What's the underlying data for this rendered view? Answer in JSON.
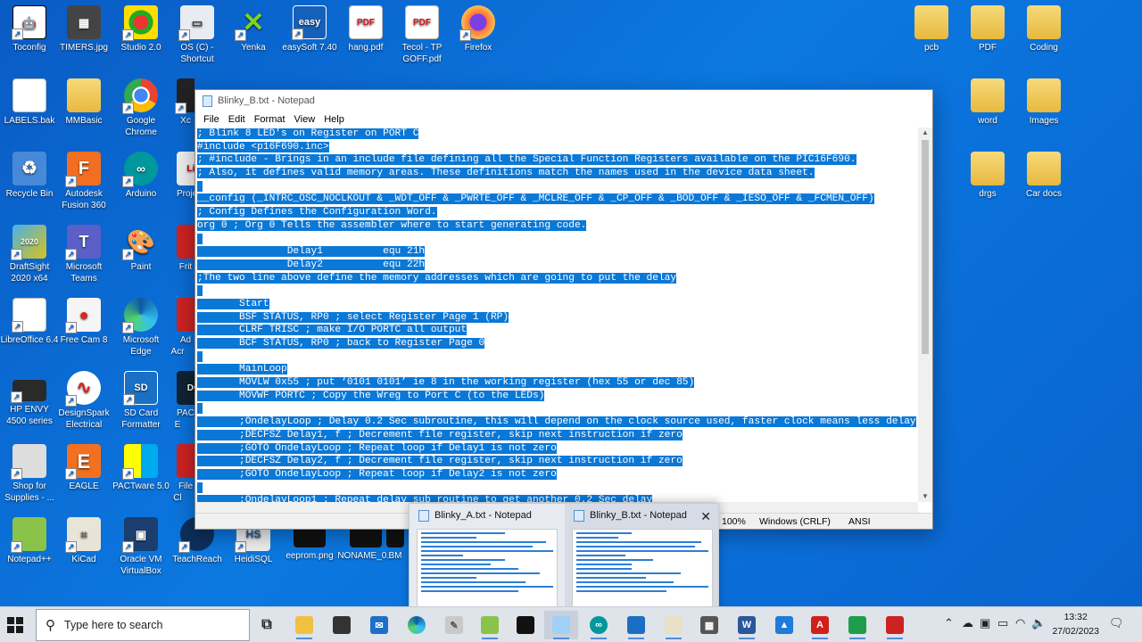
{
  "desktop": {
    "icons": {
      "toconfig": "Toconfig",
      "timers": "TIMERS.jpg",
      "studio": "Studio 2.0",
      "os_c": "OS (C) - Shortcut",
      "yenka": "Yenka",
      "easysoft": "easySoft 7.40",
      "hang": "hang.pdf",
      "tecol": "Tecol - TP GOFF.pdf",
      "firefox": "Firefox",
      "labels": "LABELS.bak",
      "mmbasic": "MMBasic",
      "chrome": "Google Chrome",
      "xc": "Xc",
      "recycle": "Recycle Bin",
      "fusion": "Autodesk Fusion 360",
      "arduino": "Arduino",
      "proje": "Proje",
      "draftsight": "DraftSight 2020 x64",
      "teams": "Microsoft Teams",
      "paint": "Paint",
      "frit": "Frit",
      "libreoffice": "LibreOffice 6.4",
      "freecam": "Free Cam 8",
      "edge": "Microsoft Edge",
      "ad": "Ad Acr",
      "hpenvy": "HP ENVY 4500 series",
      "designspark": "DesignSpark Electrical",
      "sdcard": "SD Card Formatter",
      "pactw": "PACTw E",
      "shop": "Shop for Supplies - ...",
      "eagle": "EAGLE",
      "pactware": "PACTware 5.0",
      "file": "File Cl",
      "notepadpp": "Notepad++",
      "kicad": "KiCad",
      "virtualbox": "Oracle VM VirtualBox",
      "teachreach": "TeachReach",
      "heidisql": "HeidiSQL",
      "eeprom": "eeprom.png",
      "noname": "NONAME_0...",
      "bm": "BM",
      "pcb": "pcb",
      "pdf": "PDF",
      "coding": "Coding",
      "word": "word",
      "images": "Images",
      "drgs": "drgs",
      "cardocs": "Car docs"
    }
  },
  "notepad": {
    "title": "Blinky_B.txt - Notepad",
    "menu": {
      "file": "File",
      "edit": "Edit",
      "format": "Format",
      "view": "View",
      "help": "Help"
    },
    "lines": [
      "; Blink 8 LED's on Register on PORT C",
      "#include <p16F690.inc>",
      "; #include - Brings in an include file defining all the Special Function Registers available on the PIC16F690.",
      "; Also, it defines valid memory areas. These definitions match the names used in the device data sheet.",
      "",
      "__config (_INTRC_OSC_NOCLKOUT & _WDT_OFF & _PWRTE_OFF & _MCLRE_OFF & _CP_OFF & _BOD_OFF & _IESO_OFF & _FCMEN_OFF)",
      "; Config Defines the Configuration Word.",
      "org 0 ; Org 0 Tells the assembler where to start generating code.",
      "",
      "               Delay1          equ 21h",
      "               Delay2          equ 22h",
      ";The two line above define the memory addresses which are going to put the delay",
      "",
      "       Start",
      "       BSF STATUS, RP0 ; select Register Page 1 (RP)",
      "       CLRF TRISC ; make I/O PORTC all output",
      "       BCF STATUS, RP0 ; back to Register Page 0",
      "",
      "       MainLoop",
      "       MOVLW 0x55 ; put ‘0101 0101’ ie 8 in the working register (hex 55 or dec 85)",
      "       MOVWF PORTC ; Copy the Wreg to Port C (to the LEDs)",
      "",
      "       ;OndelayLoop ; Delay 0.2 Sec subroutine, this will depend on the clock source used, faster clock means less delay",
      "       ;DECFSZ Delay1, f ; Decrement file register, skip next instruction if zero",
      "       ;GOTO OndelayLoop ; Repeat loop if Delay1 is not zero",
      "       ;DECFSZ Delay2, f ; Decrement file register, skip next instruction if zero",
      "       ;GOTO OndelayLoop ; Repeat loop if Delay2 is not zero",
      "",
      "       ;OndelayLoop1 ; Repeat delay sub routine to get another 0.2 Sec delay"
    ],
    "status": {
      "zoom": "100%",
      "line_ending": "Windows (CRLF)",
      "encoding": "ANSI"
    }
  },
  "thumbnails": [
    {
      "title": "Blinky_A.txt - Notepad"
    },
    {
      "title": "Blinky_B.txt - Notepad",
      "close": "✕"
    }
  ],
  "taskbar": {
    "search_placeholder": "Type here to search",
    "time": "13:32",
    "date": "27/02/2023"
  },
  "colors": {
    "selection": "#0a78d7",
    "desktop": "#0b6fd8"
  }
}
